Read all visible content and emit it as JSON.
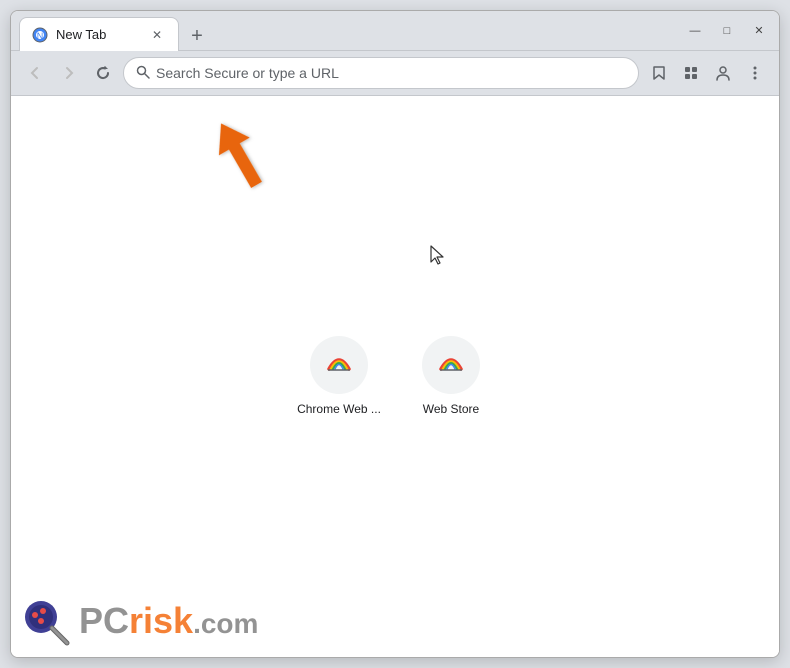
{
  "window": {
    "title": "New Tab",
    "controls": {
      "minimize": "—",
      "maximize": "□",
      "close": "✕"
    }
  },
  "tab": {
    "title": "New Tab",
    "close_label": "✕"
  },
  "new_tab_button": "+",
  "nav": {
    "back_title": "Back",
    "forward_title": "Forward",
    "reload_title": "Reload",
    "address_placeholder": "Search Secure or type a URL"
  },
  "toolbar": {
    "bookmark_title": "Bookmark",
    "extensions_title": "Extensions",
    "profile_title": "Profile",
    "menu_title": "More"
  },
  "shortcuts": [
    {
      "id": "chrome-web-store",
      "label": "Chrome Web ...",
      "icon_type": "chrome-ws"
    },
    {
      "id": "web-store",
      "label": "Web Store",
      "icon_type": "chrome-ws"
    }
  ],
  "watermark": {
    "pc": "PC",
    "risk": "risk",
    "domain": ".com"
  }
}
